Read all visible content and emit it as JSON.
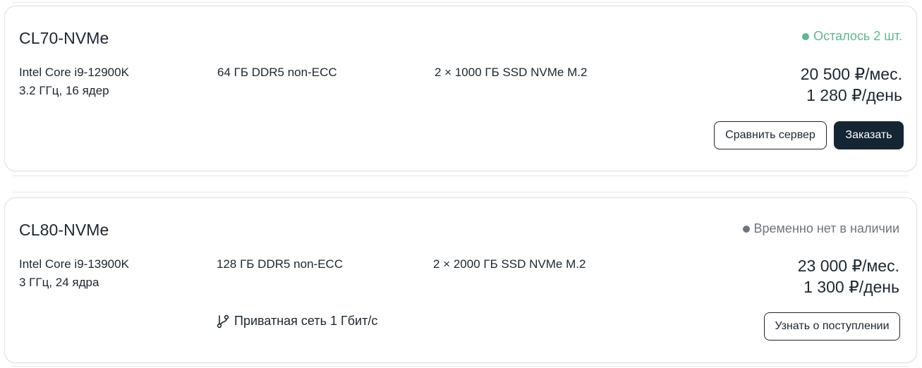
{
  "colors": {
    "in_stock": "#5cb88a",
    "out_of_stock": "#6b7680",
    "primary_button": "#142533",
    "text": "#1b2731"
  },
  "servers": [
    {
      "name": "CL70-NVMe",
      "status": "Осталось 2 шт.",
      "cpu_model": "Intel Core i9-12900K",
      "cpu_details": "3.2 ГГц, 16 ядер",
      "ram": "64 ГБ DDR5 non-ECC",
      "storage": "2 × 1000 ГБ SSD NVMe M.2",
      "price_month": "20 500 ₽/мес.",
      "price_day": "1 280 ₽/день",
      "compare_label": "Сравнить сервер",
      "order_label": "Заказать"
    },
    {
      "name": "CL80-NVMe",
      "status": "Временно нет в наличии",
      "cpu_model": "Intel Core i9-13900K",
      "cpu_details": "3 ГГц, 24 ядра",
      "ram": "128 ГБ DDR5 non-ECC",
      "storage": "2 × 2000 ГБ SSD NVMe M.2",
      "network_icon": "branch-icon",
      "network": "Приватная сеть 1 Гбит/с",
      "price_month": "23 000 ₽/мес.",
      "price_day": "1 300 ₽/день",
      "notify_label": "Узнать о поступлении"
    }
  ]
}
